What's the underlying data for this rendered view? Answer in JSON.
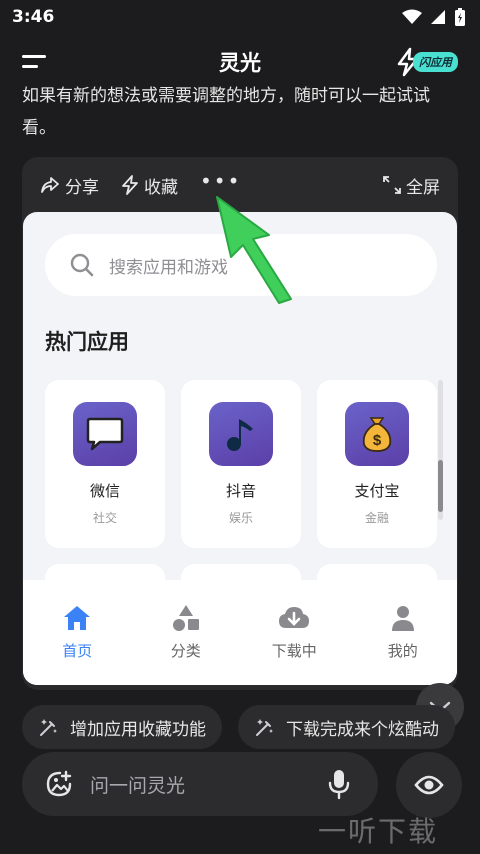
{
  "status": {
    "time": "3:46"
  },
  "header": {
    "title": "灵光",
    "flash_badge": "闪应用"
  },
  "chat": {
    "text": "如果有新的想法或需要调整的地方，随时可以一起试试看。"
  },
  "card": {
    "toolbar": {
      "share": "分享",
      "favorite": "收藏",
      "more": "•••",
      "fullscreen": "全屏"
    },
    "preview": {
      "search_placeholder": "搜索应用和游戏",
      "section_title": "热门应用",
      "apps": [
        {
          "name": "微信",
          "category": "社交",
          "icon": "chat-bubble-icon"
        },
        {
          "name": "抖音",
          "category": "娱乐",
          "icon": "music-note-icon"
        },
        {
          "name": "支付宝",
          "category": "金融",
          "icon": "money-bag-icon"
        }
      ],
      "nav": [
        {
          "label": "首页",
          "icon": "home-icon",
          "active": true
        },
        {
          "label": "分类",
          "icon": "category-icon",
          "active": false
        },
        {
          "label": "下载中",
          "icon": "cloud-download-icon",
          "active": false
        },
        {
          "label": "我的",
          "icon": "user-icon",
          "active": false
        }
      ]
    }
  },
  "suggestions": [
    "增加应用收藏功能",
    "下载完成来个炫酷动"
  ],
  "input": {
    "placeholder": "问一问灵光"
  },
  "watermark": "一听下载",
  "colors": {
    "accent": "#3b82f6",
    "badge": "#49e0d2",
    "arrow": "#3fcf5a",
    "app_icon": "#6a63c9"
  }
}
